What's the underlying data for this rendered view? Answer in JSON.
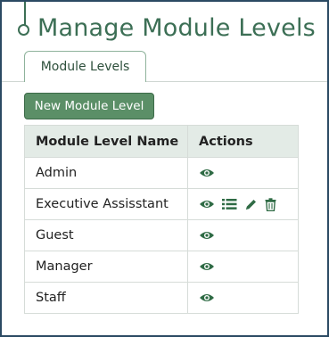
{
  "page": {
    "title": "Manage Module Levels"
  },
  "tabs": [
    {
      "label": "Module Levels"
    }
  ],
  "toolbar": {
    "new_label": "New Module Level"
  },
  "table": {
    "headers": [
      "Module Level Name",
      "Actions"
    ],
    "rows": [
      {
        "name": "Admin",
        "actions": [
          "view-icon"
        ]
      },
      {
        "name": "Executive Assisstant",
        "actions": [
          "view-icon",
          "list-icon",
          "edit-icon",
          "delete-icon"
        ]
      },
      {
        "name": "Guest",
        "actions": [
          "view-icon"
        ]
      },
      {
        "name": "Manager",
        "actions": [
          "view-icon"
        ]
      },
      {
        "name": "Staff",
        "actions": [
          "view-icon"
        ]
      }
    ]
  },
  "colors": {
    "accent": "#3c6f55",
    "button": "#5b8f67",
    "header_bg": "#e3ebe6"
  }
}
